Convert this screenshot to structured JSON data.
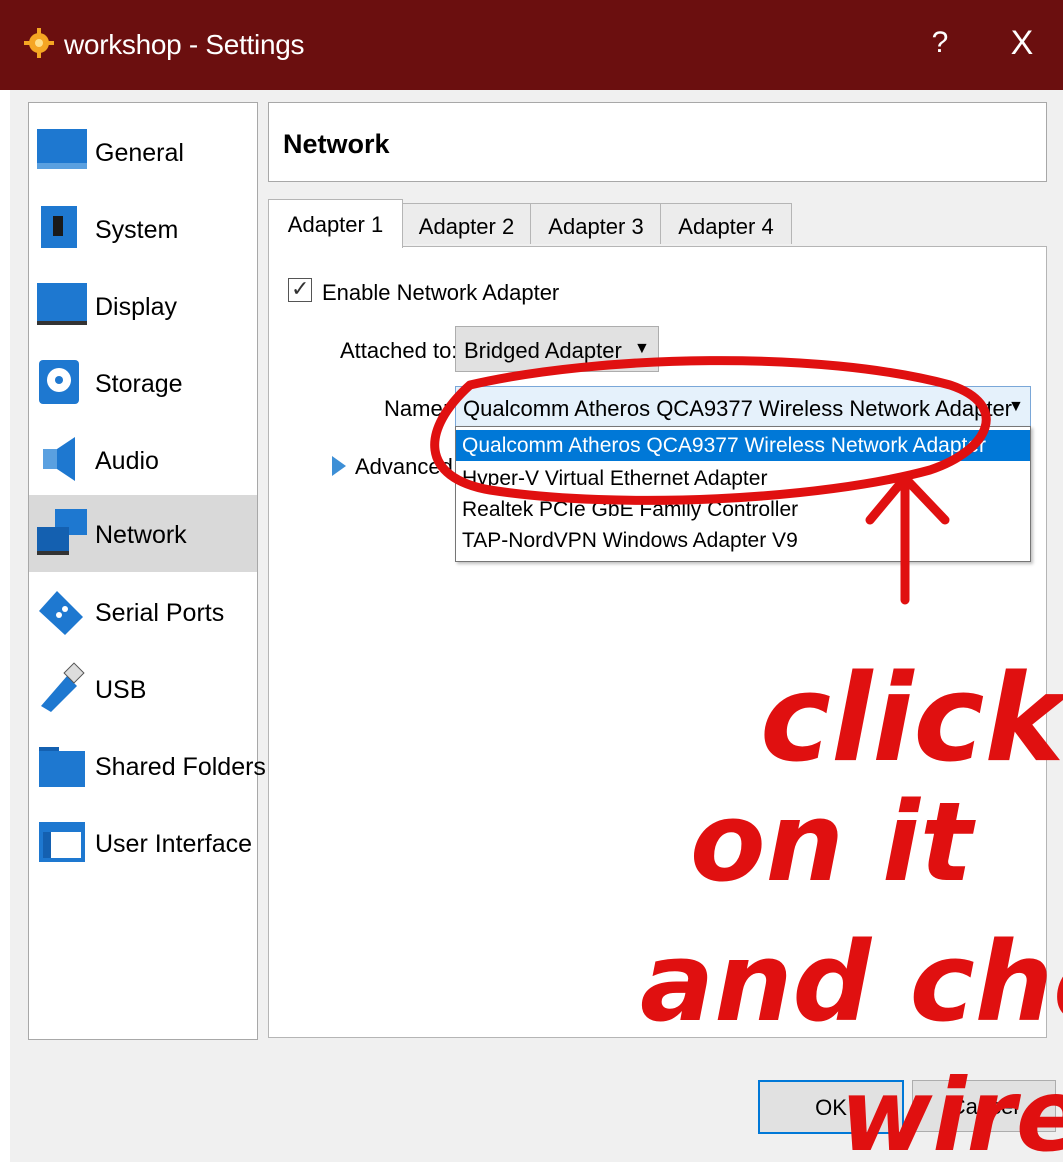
{
  "window": {
    "title": "workshop - Settings",
    "help_glyph": "?",
    "close_glyph": "X",
    "title_color": "#6b0f0f"
  },
  "sidebar": {
    "items": [
      {
        "label": "General",
        "icon": "general-icon",
        "active": false
      },
      {
        "label": "System",
        "icon": "system-icon",
        "active": false
      },
      {
        "label": "Display",
        "icon": "display-icon",
        "active": false
      },
      {
        "label": "Storage",
        "icon": "storage-icon",
        "active": false
      },
      {
        "label": "Audio",
        "icon": "audio-icon",
        "active": false
      },
      {
        "label": "Network",
        "icon": "network-icon",
        "active": true
      },
      {
        "label": "Serial Ports",
        "icon": "serial-ports-icon",
        "active": false
      },
      {
        "label": "USB",
        "icon": "usb-icon",
        "active": false
      },
      {
        "label": "Shared Folders",
        "icon": "shared-folders-icon",
        "active": false
      },
      {
        "label": "User Interface",
        "icon": "user-interface-icon",
        "active": false
      }
    ]
  },
  "page": {
    "title": "Network"
  },
  "tabs": [
    {
      "label": "Adapter 1",
      "active": true
    },
    {
      "label": "Adapter 2",
      "active": false
    },
    {
      "label": "Adapter 3",
      "active": false
    },
    {
      "label": "Adapter 4",
      "active": false
    }
  ],
  "adapter": {
    "enable_label": "Enable Network Adapter",
    "enabled": true,
    "check_glyph": "✓",
    "attached_label": "Attached to:",
    "attached_value": "Bridged Adapter",
    "name_label": "Name:",
    "name_value": "Qualcomm Atheros QCA9377 Wireless Network Adapter",
    "advanced_label": "Advanced",
    "dropdown_arrow": "▼"
  },
  "name_options": [
    "Qualcomm Atheros QCA9377 Wireless Network Adapter",
    "Hyper-V Virtual Ethernet Adapter",
    "Realtek PCIe GbE Family Controller",
    "TAP-NordVPN Windows Adapter V9"
  ],
  "buttons": {
    "ok": "OK",
    "cancel": "Cancel"
  },
  "annotation": {
    "text_lines": [
      "click",
      "on it",
      "and check",
      "wirel..."
    ],
    "color": "#e01010"
  }
}
